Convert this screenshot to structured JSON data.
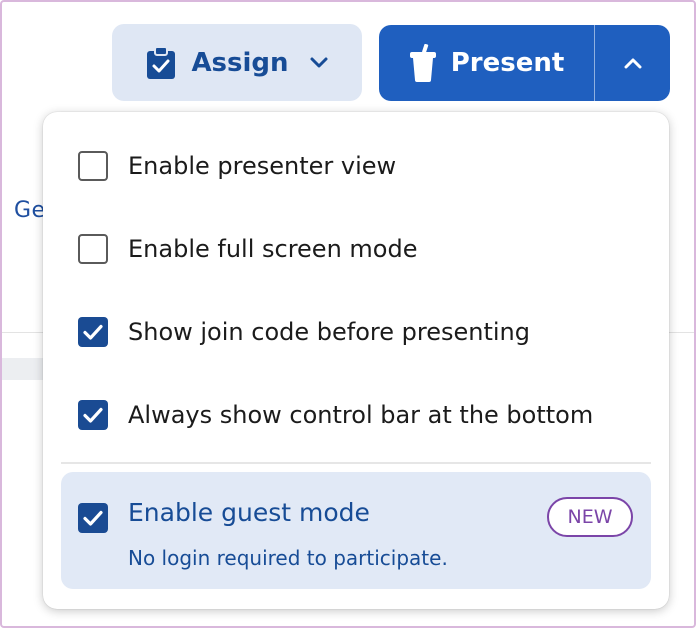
{
  "background": {
    "link_fragment": "Ge"
  },
  "toolbar": {
    "assign_label": "Assign",
    "present_label": "Present"
  },
  "dropdown": {
    "options": [
      {
        "label": "Enable presenter view",
        "checked": false
      },
      {
        "label": "Enable full screen mode",
        "checked": false
      },
      {
        "label": "Show join code before presenting",
        "checked": true
      },
      {
        "label": "Always show control bar at the bottom",
        "checked": true
      }
    ],
    "guest": {
      "label": "Enable guest mode",
      "description": "No login required to participate.",
      "badge": "NEW",
      "checked": true
    }
  },
  "colors": {
    "primary": "#1f5fbf",
    "assign_bg": "#dfe7f4",
    "checkbox_on": "#1a4b93",
    "guest_bg": "#e1e9f6",
    "badge": "#7b45a8"
  },
  "icons": {
    "assign": "clipboard-check-icon",
    "assign_caret": "chevron-down-icon",
    "present": "cup-icon",
    "present_caret": "chevron-up-icon"
  }
}
